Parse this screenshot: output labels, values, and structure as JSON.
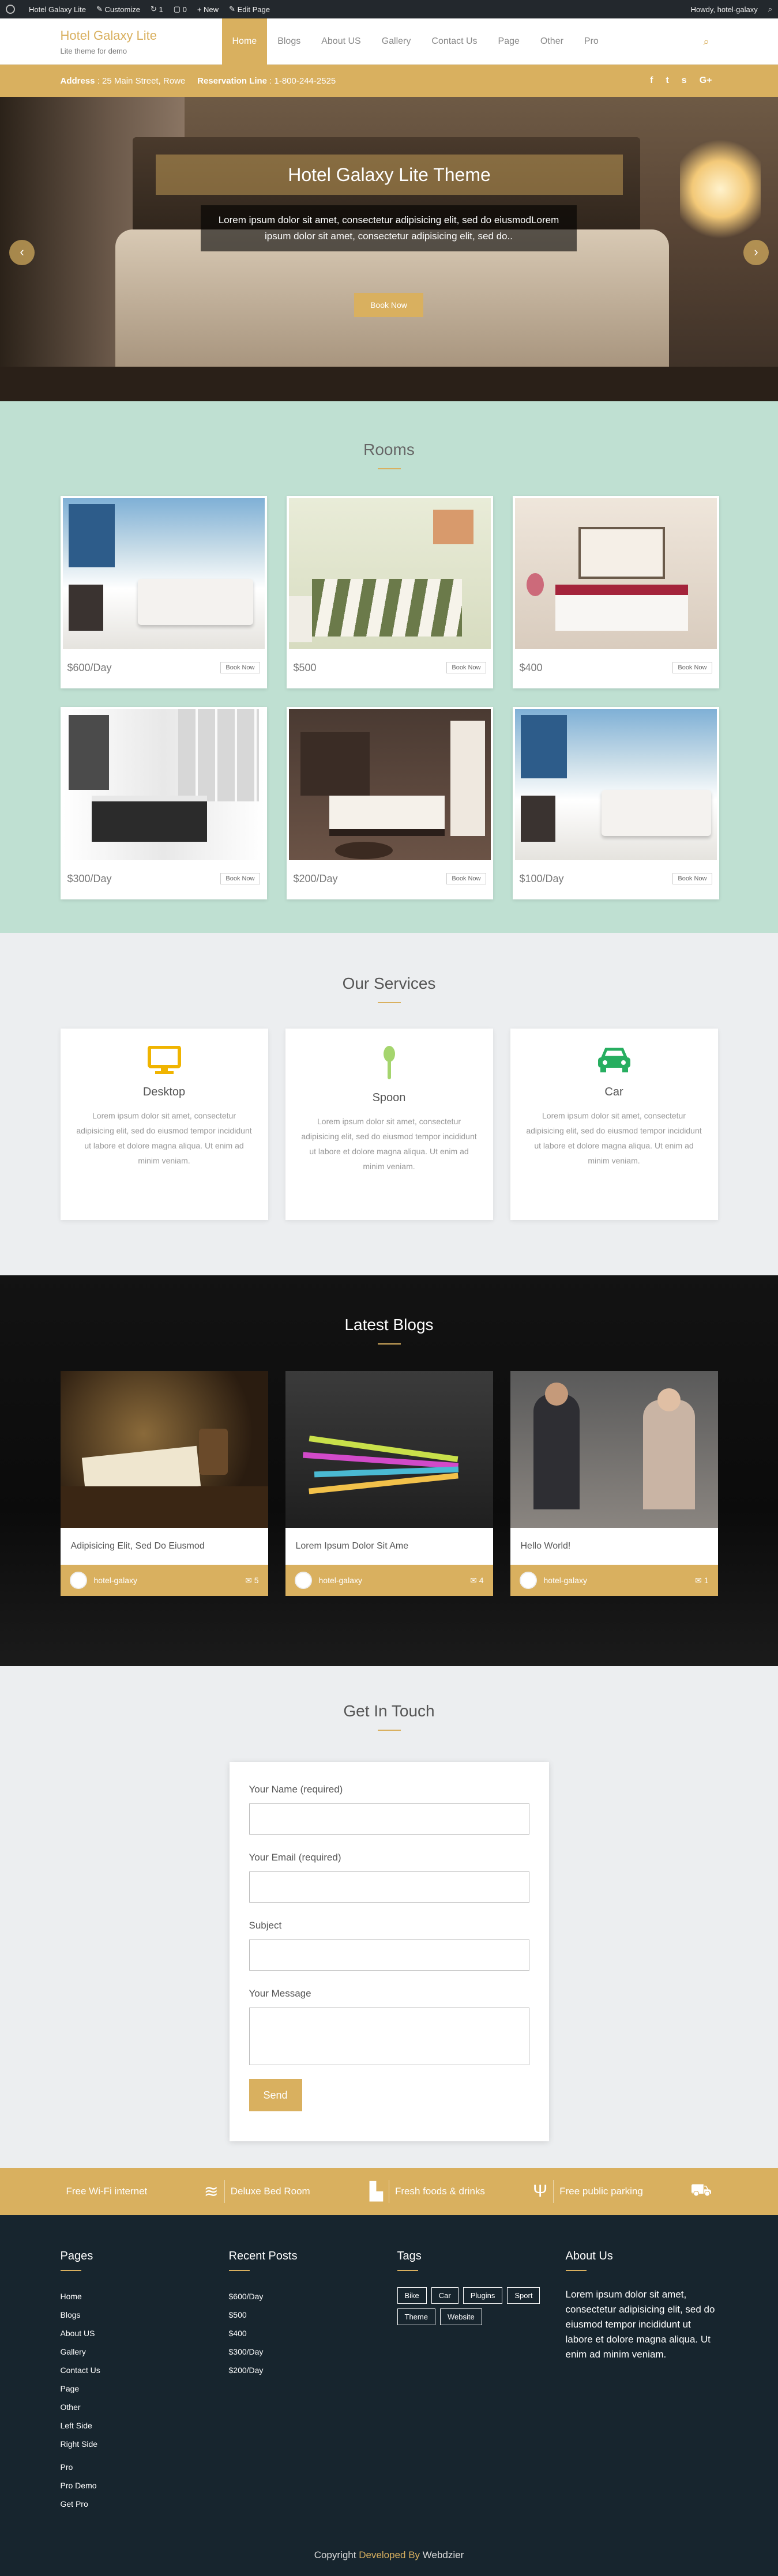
{
  "adminbar": {
    "site": "Hotel Galaxy Lite",
    "customize": "Customize",
    "updates": "1",
    "comments": "0",
    "new": "+ New",
    "edit": "Edit Page",
    "howdy": "Howdy, hotel-galaxy"
  },
  "header": {
    "title": "Hotel Galaxy Lite",
    "tagline": "Lite theme for demo",
    "nav": [
      "Home",
      "Blogs",
      "About US",
      "Gallery",
      "Contact Us",
      "Page",
      "Other",
      "Pro"
    ]
  },
  "info": {
    "address_label": "Address",
    "address": ": 25 Main Street, Rowe",
    "reservation_label": "Reservation Line",
    "reservation": ": 1-800-244-2525",
    "social": [
      "f",
      "t",
      "s",
      "G+"
    ]
  },
  "hero": {
    "title": "Hotel Galaxy Lite Theme",
    "desc": "Lorem ipsum dolor sit amet, consectetur adipisicing elit, sed do eiusmodLorem ipsum dolor sit amet, consectetur adipisicing elit, sed do..",
    "button": "Book Now"
  },
  "rooms": {
    "title": "Rooms",
    "button": "Book Now",
    "items": [
      {
        "price": "$600/Day"
      },
      {
        "price": "$500"
      },
      {
        "price": "$400"
      },
      {
        "price": "$300/Day"
      },
      {
        "price": "$200/Day"
      },
      {
        "price": "$100/Day"
      }
    ]
  },
  "services": {
    "title": "Our Services",
    "items": [
      {
        "name": "Desktop",
        "color": "#f0b400",
        "text": "Lorem ipsum dolor sit amet, consectetur adipisicing elit, sed do eiusmod tempor incididunt ut labore et dolore magna aliqua. Ut enim ad minim veniam."
      },
      {
        "name": "Spoon",
        "color": "#a5d56e",
        "text": "Lorem ipsum dolor sit amet, consectetur adipisicing elit, sed do eiusmod tempor incididunt ut labore et dolore magna aliqua. Ut enim ad minim veniam."
      },
      {
        "name": "Car",
        "color": "#27ae60",
        "text": "Lorem ipsum dolor sit amet, consectetur adipisicing elit, sed do eiusmod tempor incididunt ut labore et dolore magna aliqua. Ut enim ad minim veniam."
      }
    ]
  },
  "blogs": {
    "title": "Latest Blogs",
    "items": [
      {
        "title": "Adipisicing Elit, Sed Do Eiusmod",
        "author": "hotel-galaxy",
        "comments": "5"
      },
      {
        "title": "Lorem Ipsum Dolor Sit Ame",
        "author": "hotel-galaxy",
        "comments": "4"
      },
      {
        "title": "Hello World!",
        "author": "hotel-galaxy",
        "comments": "1"
      }
    ]
  },
  "contact": {
    "title": "Get In Touch",
    "name_label": "Your Name (required)",
    "email_label": "Your Email (required)",
    "subject_label": "Subject",
    "message_label": "Your Message",
    "send": "Send"
  },
  "features": [
    {
      "label": "Free Wi-Fi internet",
      "icon": "wifi-icon",
      "glyph": "≋"
    },
    {
      "label": "Deluxe Bed Room",
      "icon": "bed-icon",
      "glyph": "▙"
    },
    {
      "label": "Fresh foods & drinks",
      "icon": "cutlery-icon",
      "glyph": "Ψ"
    },
    {
      "label": "Free public parking",
      "icon": "car-icon",
      "glyph": "⛟"
    }
  ],
  "footer": {
    "pages_title": "Pages",
    "pages": [
      "Home",
      "Blogs",
      "About US",
      "Gallery",
      "Contact Us",
      "Page",
      "Other",
      "Left Side",
      "Right Side",
      "Pro",
      "Pro Demo",
      "Get Pro"
    ],
    "recent_title": "Recent Posts",
    "recent": [
      "$600/Day",
      "$500",
      "$400",
      "$300/Day",
      "$200/Day"
    ],
    "tags_title": "Tags",
    "tags": [
      "Bike",
      "Car",
      "Plugins",
      "Sport",
      "Theme",
      "Website"
    ],
    "about_title": "About Us",
    "about": "Lorem ipsum dolor sit amet, consectetur adipisicing elit, sed do eiusmod tempor incididunt ut labore et dolore magna aliqua. Ut enim ad minim veniam.",
    "copyright": "Copyright",
    "developed": "Developed By",
    "dev_name": "Webdzier"
  }
}
